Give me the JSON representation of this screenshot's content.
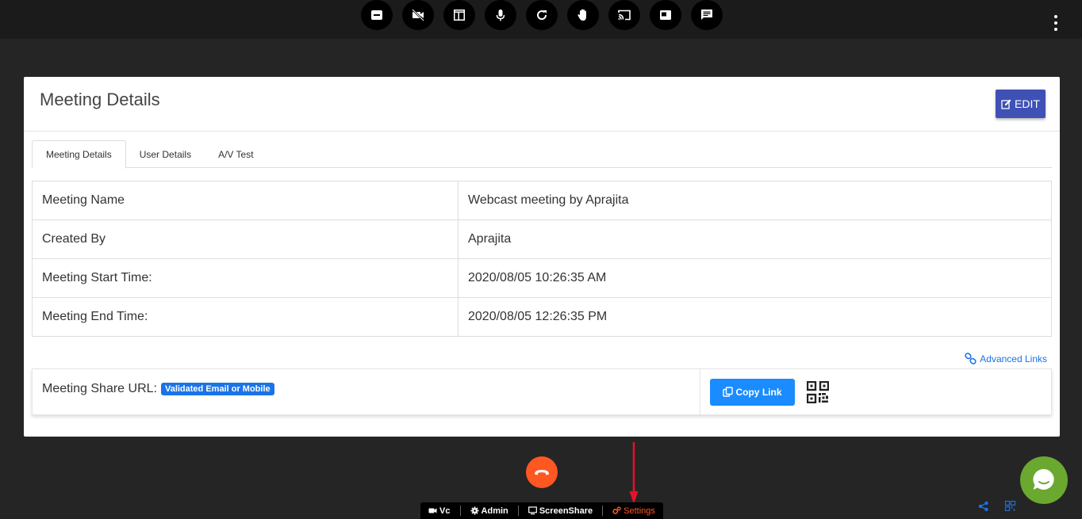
{
  "toolbar": {
    "icons": [
      "minus-circle-icon",
      "video-off-icon",
      "layout-icon",
      "mic-icon",
      "refresh-icon",
      "raise-hand-icon",
      "cast-icon",
      "picture-in-picture-icon",
      "chat-icon"
    ]
  },
  "card": {
    "title": "Meeting Details",
    "edit_label": "EDIT"
  },
  "tabs": [
    {
      "label": "Meeting Details",
      "active": true
    },
    {
      "label": "User Details",
      "active": false
    },
    {
      "label": "A/V Test",
      "active": false
    }
  ],
  "details": [
    {
      "label": "Meeting Name",
      "value": "Webcast meeting by Aprajita"
    },
    {
      "label": "Created By",
      "value": "Aprajita"
    },
    {
      "label": "Meeting Start Time:",
      "value": "2020/08/05 10:26:35 AM"
    },
    {
      "label": "Meeting End Time:",
      "value": "2020/08/05 12:26:35 PM"
    }
  ],
  "advanced_links": "Advanced Links",
  "share": {
    "label": "Meeting Share URL:",
    "badge": "Validated Email or Mobile",
    "copy_label": "Copy Link"
  },
  "bottom_bar": {
    "items": [
      {
        "label": "Vc",
        "icon": "video-icon"
      },
      {
        "label": "Admin",
        "icon": "gear-icon"
      },
      {
        "label": "ScreenShare",
        "icon": "monitor-icon"
      },
      {
        "label": "Settings",
        "icon": "gears-icon"
      }
    ]
  },
  "colors": {
    "accent": "#3f51b5",
    "link": "#1a73e8",
    "hangup": "#ff5722",
    "chat": "#6aa830",
    "arrow": "#e8102a"
  }
}
